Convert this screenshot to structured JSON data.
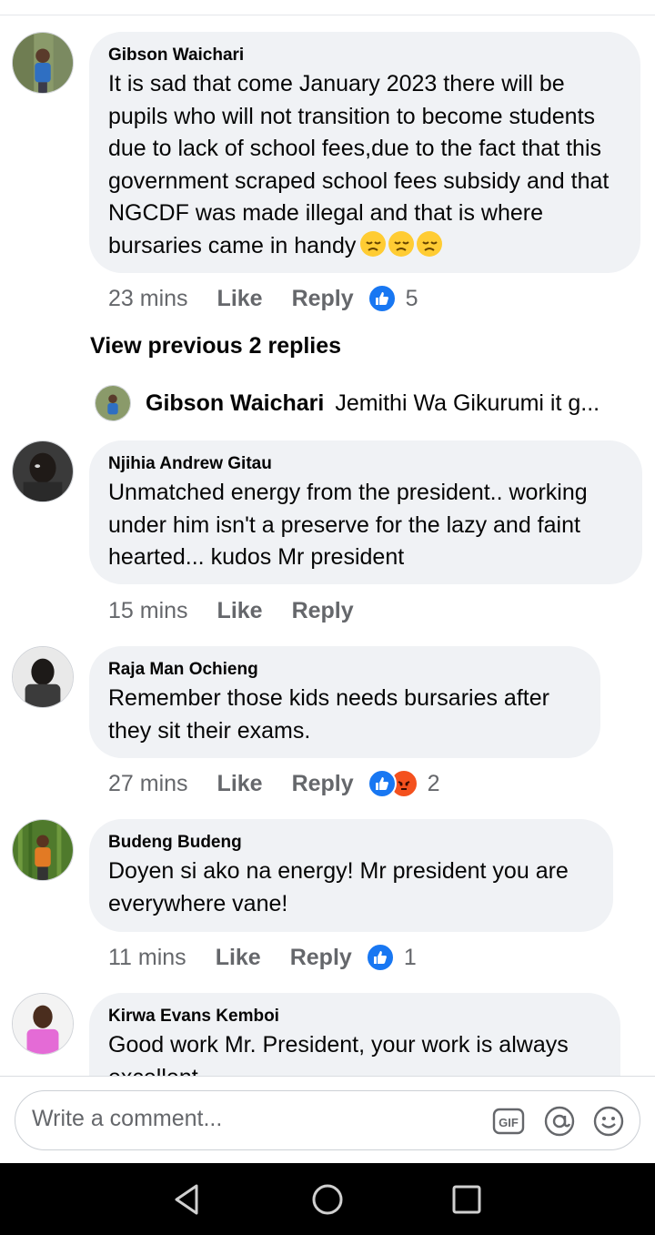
{
  "comments": [
    {
      "author": "Gibson Waichari",
      "text": "It is sad that come January 2023 there will be pupils who will not transition to become students due to lack of school fees,due to the fact that this government scraped school fees subsidy and that NGCDF was made illegal and that is where bursaries came in handy",
      "time": "23 mins",
      "like_label": "Like",
      "reply_label": "Reply",
      "reaction_count": "5",
      "reactions": [
        "like"
      ],
      "trailing_emoji": [
        "disappointed-emoji",
        "disappointed-emoji",
        "disappointed-emoji"
      ]
    },
    {
      "author": "Njihia Andrew Gitau",
      "text": "Unmatched energy from the president.. working under him isn't a preserve for the lazy and faint hearted... kudos Mr president",
      "time": "15 mins",
      "like_label": "Like",
      "reply_label": "Reply"
    },
    {
      "author": "Raja Man Ochieng",
      "text": "Remember those kids needs bursaries after they sit their exams.",
      "time": "27 mins",
      "like_label": "Like",
      "reply_label": "Reply",
      "reaction_count": "2",
      "reactions": [
        "like",
        "angry"
      ]
    },
    {
      "author": "Budeng Budeng",
      "text": "Doyen si ako na energy! Mr president you are everywhere vane!",
      "time": "11 mins",
      "like_label": "Like",
      "reply_label": "Reply",
      "reaction_count": "1",
      "reactions": [
        "like"
      ]
    },
    {
      "author": "Kirwa Evans Kemboi",
      "text": "Good work Mr. President, your work is always excellent"
    }
  ],
  "view_previous": "View previous 2 replies",
  "reply_preview": {
    "author": "Gibson Waichari",
    "text": "Jemithi Wa Gikurumi it g..."
  },
  "composer": {
    "placeholder": "Write a comment...",
    "icons": [
      "gif-icon",
      "mention-icon",
      "emoji-icon"
    ]
  },
  "navbar": {
    "icons": [
      "back-icon",
      "home-icon",
      "recents-icon"
    ]
  },
  "colors": {
    "bubble": "#f0f2f5",
    "meta_text": "#65676b",
    "like_blue": "#1877f2",
    "angry_orange": "#f4511e"
  }
}
